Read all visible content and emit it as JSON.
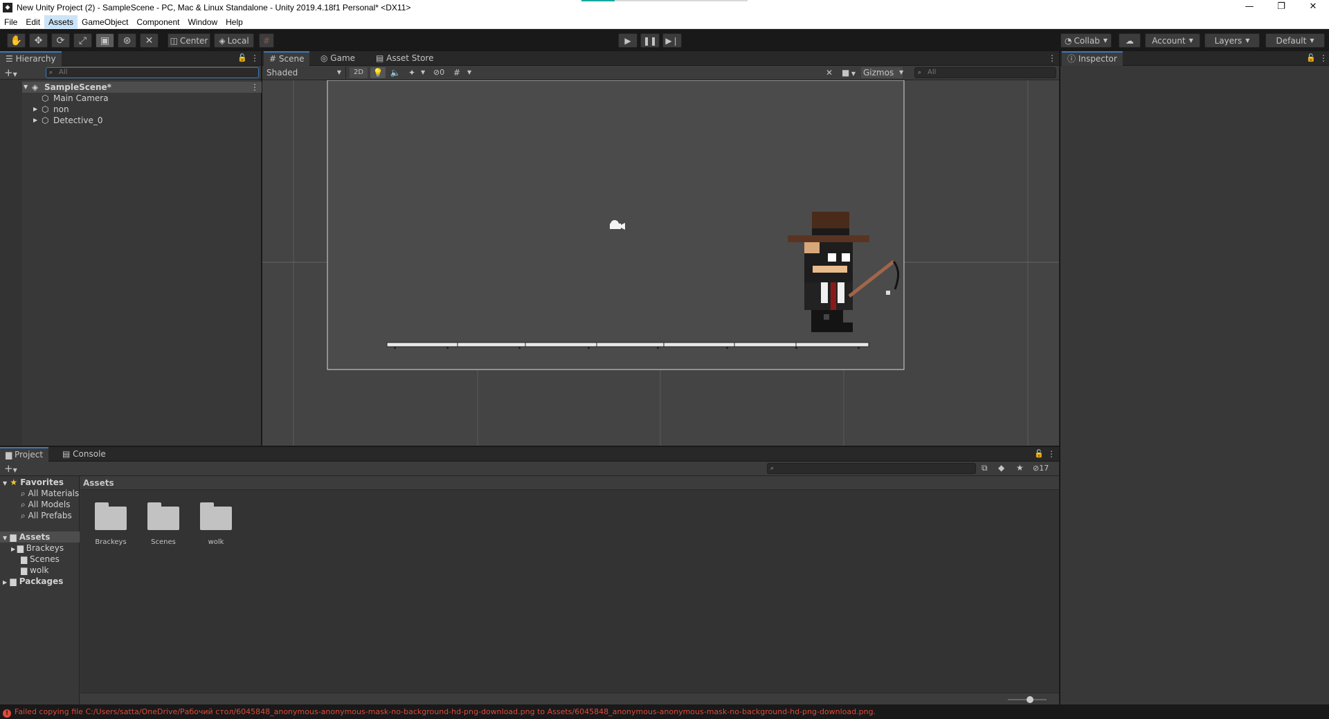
{
  "window": {
    "title": "New Unity Project (2) - SampleScene - PC, Mac & Linux Standalone - Unity 2019.4.18f1 Personal* <DX11>",
    "controls": [
      "—",
      "❐",
      "✕"
    ]
  },
  "menu": [
    "File",
    "Edit",
    "Assets",
    "GameObject",
    "Component",
    "Window",
    "Help"
  ],
  "toolbar": {
    "pivot_label": "Center",
    "space_label": "Local",
    "collab_label": "Collab",
    "account_label": "Account",
    "layers_label": "Layers",
    "layout_label": "Default"
  },
  "hierarchy": {
    "tab": "Hierarchy",
    "search_placeholder": "All",
    "scene_name": "SampleScene*",
    "items": [
      "Main Camera",
      "non",
      "Detective_0"
    ]
  },
  "scene_panel": {
    "tabs": [
      "Scene",
      "Game",
      "Asset Store"
    ],
    "shading_mode": "Shaded",
    "mode_2d": "2D",
    "hidden_count": "0",
    "gizmos_label": "Gizmos",
    "search_placeholder": "All"
  },
  "inspector": {
    "tab": "Inspector"
  },
  "project_panel": {
    "tabs": [
      "Project",
      "Console"
    ],
    "favorites_label": "Favorites",
    "favorites": [
      "All Materials",
      "All Models",
      "All Prefabs"
    ],
    "assets_label": "Assets",
    "asset_folders": [
      "Brackeys",
      "Scenes",
      "wolk"
    ],
    "packages_label": "Packages",
    "breadcrumb": "Assets",
    "grid_items": [
      "Brackeys",
      "Scenes",
      "wolk"
    ],
    "hidden_packages_count": "17"
  },
  "status": {
    "message": "Failed copying file C:/Users/satta/OneDrive/Рабочий стол/6045848_anonymous-anonymous-mask-no-background-hd-png-download.png to Assets/6045848_anonymous-anonymous-mask-no-background-hd-png-download.png."
  },
  "colors": {
    "accent": "#3a79bb",
    "error": "#e0493c",
    "title_bg": "#ffffff",
    "panel_bg": "#383838"
  }
}
